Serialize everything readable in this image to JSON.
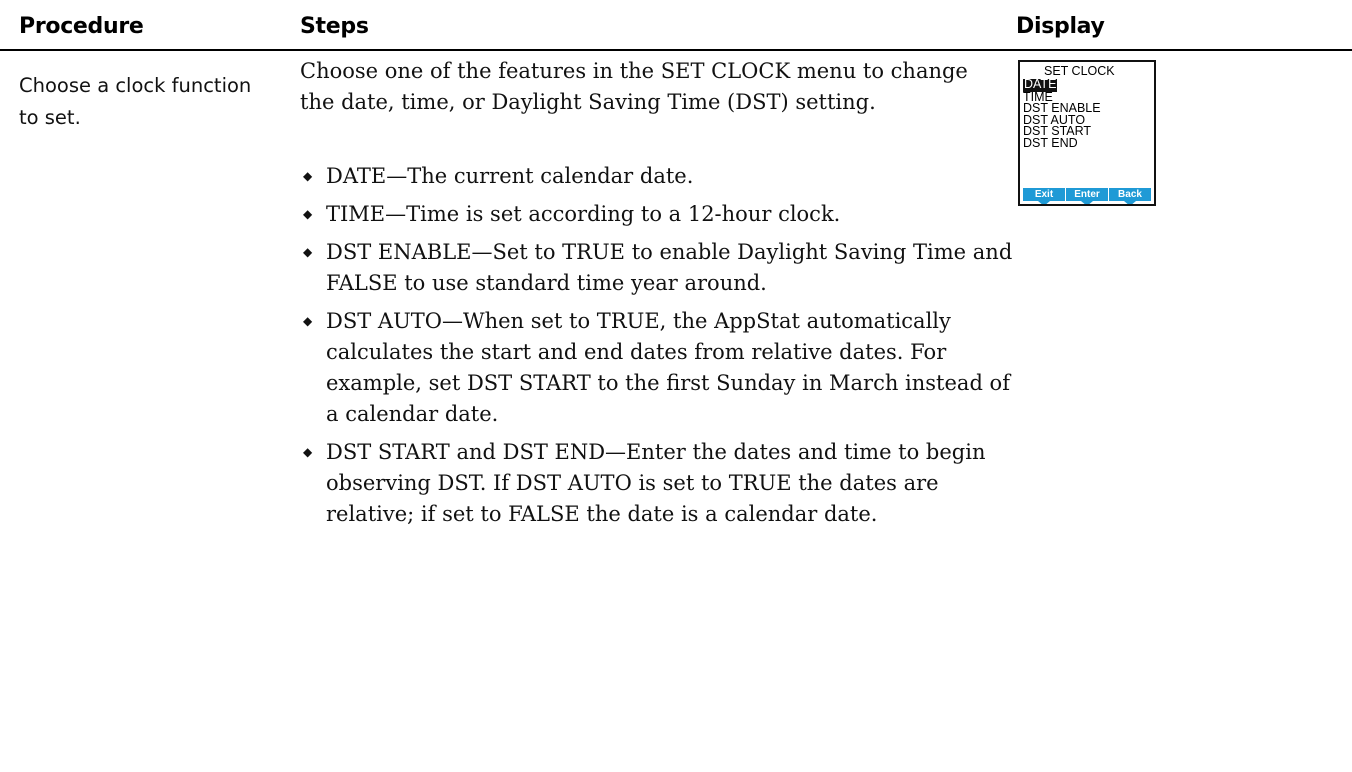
{
  "headers": {
    "procedure": "Procedure",
    "steps": "Steps",
    "display": "Display"
  },
  "row": {
    "procedure": "Choose a clock function to set.",
    "intro": "Choose one of the features in the SET CLOCK menu to change the date, time, or Daylight Saving Time (DST) setting.",
    "bullets": [
      "DATE—The current calendar date.",
      "TIME—Time is set according to a 12-hour clock.",
      "DST ENABLE—Set to TRUE to enable Daylight Saving Time and FALSE to use standard time year around.",
      "DST AUTO—When set to TRUE, the AppStat automatically calculates the start and end dates from relative dates. For example, set DST START to the first Sunday in March instead of a calendar date.",
      "DST START and DST END—Enter the dates and time to begin observing DST. If DST AUTO is set to TRUE the dates are relative; if set to FALSE the date is a calendar date."
    ],
    "bullet_icon": "diamond-bullet"
  },
  "display": {
    "title": "SET CLOCK",
    "selected_index": 0,
    "items": [
      "DATE",
      "TIME",
      "DST ENABLE",
      "DST AUTO",
      "DST START",
      "DST END"
    ],
    "softkeys": [
      "Exit",
      "Enter",
      "Back"
    ],
    "softkey_color": "#1f9ad6",
    "highlight_color": "#111111"
  }
}
